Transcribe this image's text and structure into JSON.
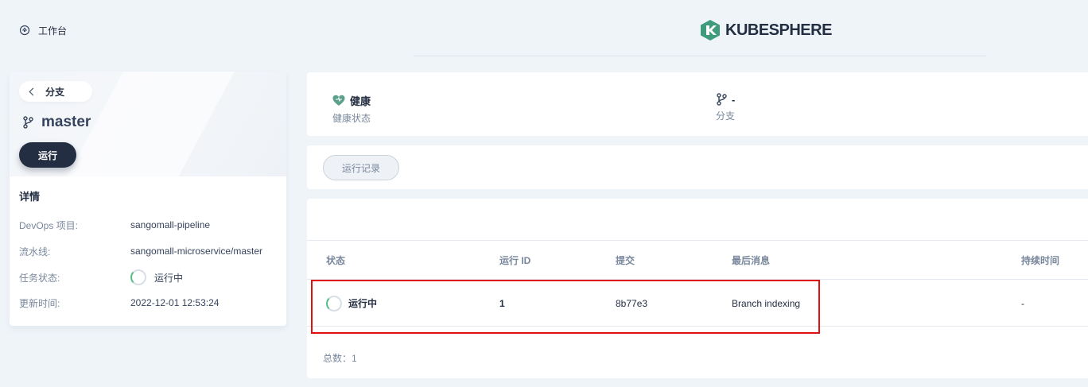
{
  "topbar": {
    "workbench_label": "工作台",
    "logo_text": "KUBESPHERE"
  },
  "sidebar": {
    "back_label": "分支",
    "branch_name": "master",
    "run_label": "运行",
    "details_title": "详情",
    "details": [
      {
        "key": "DevOps 项目:",
        "value": "sangomall-pipeline"
      },
      {
        "key": "流水线:",
        "value": "sangomall-microservice/master"
      },
      {
        "key": "任务状态:",
        "value": "运行中"
      },
      {
        "key": "更新时间:",
        "value": "2022-12-01 12:53:24"
      }
    ]
  },
  "stats": {
    "health_value": "健康",
    "health_label": "健康状态",
    "branch_value": "-",
    "branch_label": "分支"
  },
  "tabs": {
    "run_records": "运行记录"
  },
  "table": {
    "columns": [
      "状态",
      "运行 ID",
      "提交",
      "最后消息",
      "持续时间"
    ],
    "rows": [
      {
        "status": "运行中",
        "run_id": "1",
        "commit": "8b77e3",
        "message": "Branch indexing",
        "duration": "-"
      }
    ],
    "total": "总数：1"
  },
  "colors": {
    "dark": "#242e42",
    "accent_green": "#55bc8a",
    "highlight_red": "#e01010"
  }
}
